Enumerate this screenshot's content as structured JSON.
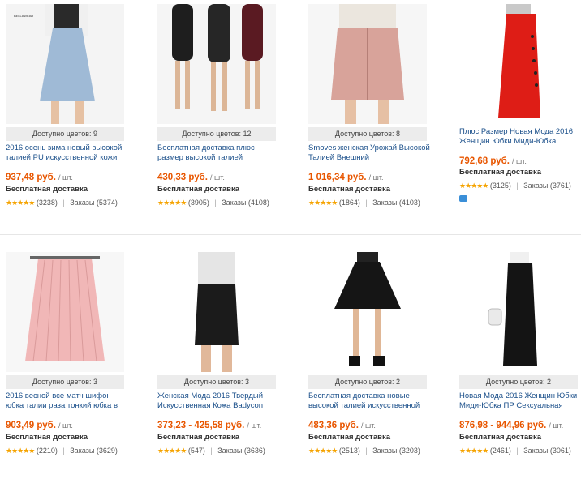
{
  "products": [
    {
      "colors_label": "Доступно цветов: 9",
      "title": "2016 осень зима новый высокой талией PU искусственной кожи",
      "price": "937,48 руб.",
      "unit": "/ шт.",
      "shipping": "Бесплатная доставка",
      "reviews": "(3238)",
      "orders": "Заказы (5374)",
      "image": "light-blue-suede-a-line-skirt",
      "logo_text": "BELLAWEAR"
    },
    {
      "colors_label": "Доступно цветов: 12",
      "title": "Бесплатная доставка плюс размер высокой талией",
      "price": "430,33 руб.",
      "unit": "/ шт.",
      "shipping": "Бесплатная доставка",
      "reviews": "(3905)",
      "orders": "Заказы (4108)",
      "image": "black-and-burgundy-leather-pencil-skirts"
    },
    {
      "colors_label": "Доступно цветов: 8",
      "title": "Smoves женская Урожай Высокой Талией Внешний",
      "price": "1 016,34 руб.",
      "unit": "/ шт.",
      "shipping": "Бесплатная доставка",
      "reviews": "(1864)",
      "orders": "Заказы (4103)",
      "image": "pink-suede-lace-up-mini-skirt"
    },
    {
      "colors_label": "",
      "title": "Плюс Размер Новая Мода 2016 Женщин Юбки Миди-Юбка",
      "price": "792,68 руб.",
      "unit": "/ шт.",
      "shipping": "Бесплатная доставка",
      "reviews": "(3125)",
      "orders": "Заказы (3761)",
      "image": "red-midi-skirt-with-buttons"
    },
    {
      "colors_label": "Доступно цветов: 3",
      "title": "2016 весной все матч шифон юбка талии раза тонкий юбка в",
      "price": "903,49 руб.",
      "unit": "/ шт.",
      "shipping": "Бесплатная доставка",
      "reviews": "(2210)",
      "orders": "Заказы (3629)",
      "image": "pink-pleated-chiffon-skirt"
    },
    {
      "colors_label": "Доступно цветов: 3",
      "title": "Женская Мода 2016 Твердый Искусственная Кожа Badycon",
      "price": "373,23 - 425,58 руб.",
      "unit": "/ шт.",
      "shipping": "Бесплатная доставка",
      "reviews": "(547)",
      "orders": "Заказы (3636)",
      "image": "black-leather-bodycon-skirt"
    },
    {
      "colors_label": "Доступно цветов: 2",
      "title": "Бесплатная доставка новые высокой талией искусственной",
      "price": "483,36 руб.",
      "unit": "/ шт.",
      "shipping": "Бесплатная доставка",
      "reviews": "(2513)",
      "orders": "Заказы (3203)",
      "image": "black-leather-skater-skirt"
    },
    {
      "colors_label": "Доступно цветов: 2",
      "title": "Новая Мода 2016 Женщин Юбки Миди-Юбка ПР Сексуальная",
      "price": "876,98 - 944,96 руб.",
      "unit": "/ шт.",
      "shipping": "Бесплатная доставка",
      "reviews": "(2461)",
      "orders": "Заказы (3061)",
      "image": "black-high-waist-midi-skirt"
    }
  ],
  "stars": "★★★★★",
  "separator": "|",
  "colors": {
    "price": "#e85600",
    "title_link": "#1a4f8a",
    "stars": "#f5a300"
  }
}
